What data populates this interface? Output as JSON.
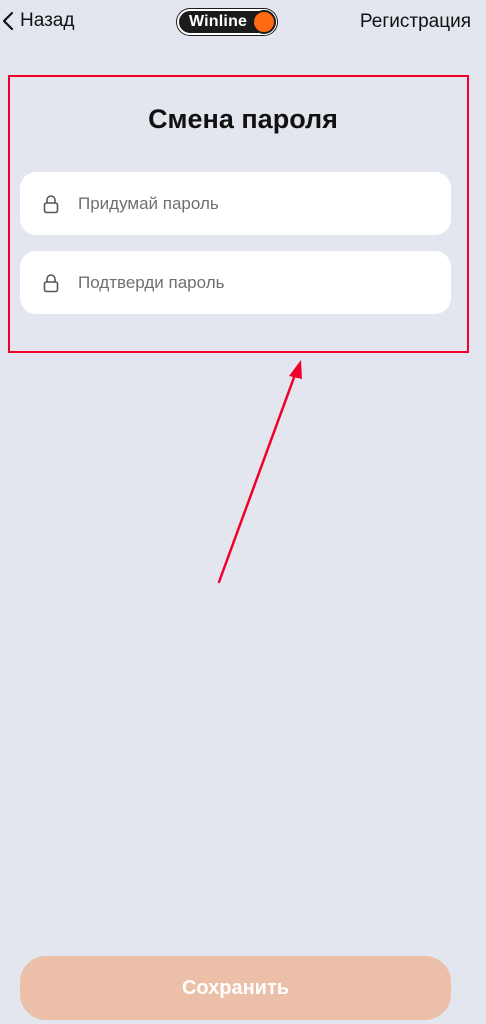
{
  "header": {
    "back_label": "Назад",
    "logo_text": "Winline",
    "register_label": "Регистрация"
  },
  "form": {
    "title": "Смена пароля",
    "new_password": {
      "placeholder": "Придумай пароль",
      "value": ""
    },
    "confirm_password": {
      "placeholder": "Подтверди пароль",
      "value": ""
    }
  },
  "actions": {
    "save_label": "Сохранить"
  },
  "icons": {
    "back": "chevron-left-icon",
    "field": "lock-icon",
    "logo_mark": "orange-dot-icon"
  },
  "colors": {
    "background": "#e3e6ef",
    "accent": "#ff6a12",
    "button_disabled": "#ecbfa8",
    "annotation": "#f2002a"
  }
}
